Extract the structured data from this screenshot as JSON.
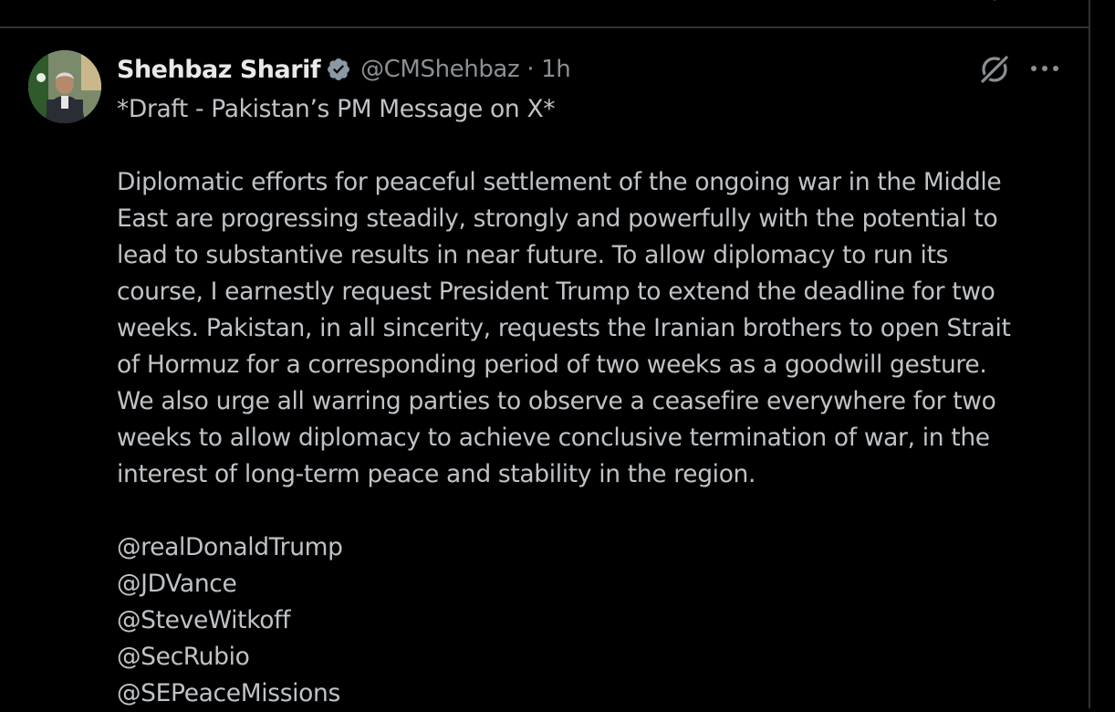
{
  "tweet": {
    "author": {
      "display_name": "Shehbaz Sharif",
      "handle": "@CMShehbaz",
      "verified": true,
      "verified_badge_color": "#8b98a5"
    },
    "separator": "·",
    "time": "1h",
    "draft_label": "*Draft - Pakistan’s PM Message on X*",
    "body_lines": [
      "Diplomatic efforts for peaceful settlement of the ongoing war in the Middle",
      "East are progressing steadily, strongly and powerfully with the potential to",
      "lead to substantive results in near future. To allow diplomacy to run its",
      "course, I earnestly request President Trump to extend the deadline for two",
      "weeks. Pakistan, in all sincerity, requests the Iranian brothers to open Strait",
      "of Hormuz for a corresponding period of two weeks as a goodwill gesture.",
      "We also urge all warring parties to observe a ceasefire everywhere for two",
      "weeks to allow diplomacy to achieve conclusive termination of war, in the",
      "interest of long-term peace and stability in the region."
    ],
    "mentions": [
      "@realDonaldTrump",
      "@JDVance",
      "@SteveWitkoff",
      "@SecRubio",
      "@SEPeaceMissions"
    ]
  },
  "icons": {
    "grok": "grok-icon",
    "more": "more-options-icon",
    "verified": "verified-badge-icon"
  },
  "colors": {
    "background": "#000000",
    "divider": "#2f3336",
    "name": "#e7e9ea",
    "secondary": "#8b9095",
    "body_text": "#bfc3c7"
  }
}
